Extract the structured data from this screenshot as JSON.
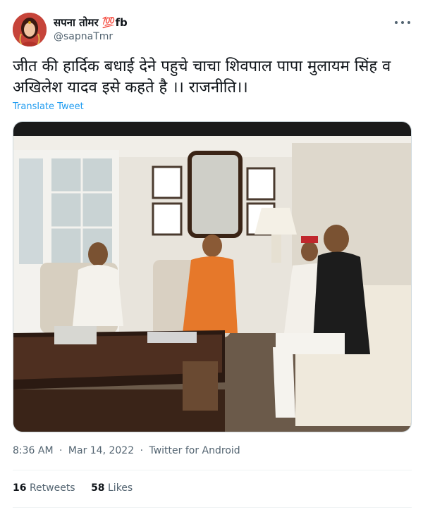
{
  "author": {
    "display_name": "सपना तोमर 💯fb",
    "handle": "@sapnaTmr"
  },
  "tweet": {
    "text": "जीत की हार्दिक बधाई देने पहुचे चाचा शिवपाल पापा मुलायम सिंह व अखिलेश यादव इसे कहते है ।। राजनीति।।",
    "translate_label": "Translate Tweet"
  },
  "meta": {
    "time": "8:36 AM",
    "separator": "·",
    "date": "Mar 14, 2022",
    "source": "Twitter for Android"
  },
  "stats": {
    "retweets_count": "16",
    "retweets_label": "Retweets",
    "likes_count": "58",
    "likes_label": "Likes"
  },
  "colors": {
    "link": "#1d9bf0",
    "secondary_text": "#536471",
    "primary_text": "#0f1419"
  },
  "icons": {
    "more": "more-horizontal-icon"
  }
}
